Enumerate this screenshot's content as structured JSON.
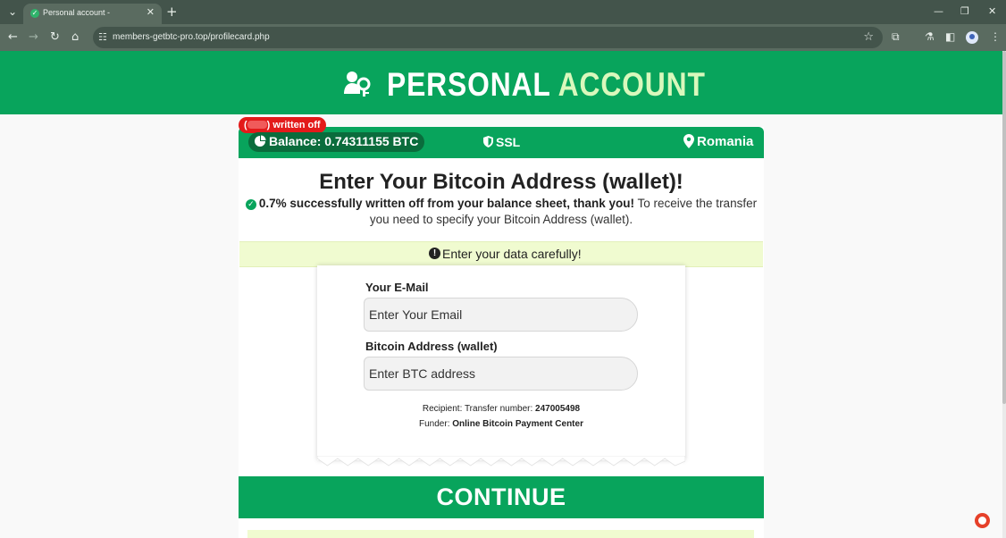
{
  "browser": {
    "tab_title": "Personal account -",
    "url": "members-getbtc-pro.top/profilecard.php"
  },
  "header": {
    "title_part1": "PERSONAL",
    "title_part2": "ACCOUNT"
  },
  "status": {
    "badge_open": "(",
    "badge_text": ") written off",
    "balance": "Balance: 0.74311155 BTC",
    "ssl": "SSL",
    "country": "Romania"
  },
  "main": {
    "headline": "Enter Your Bitcoin Address (wallet)!",
    "success_bold": "0.7% successfully written off from your balance sheet, thank you!",
    "success_rest": "To receive the transfer you need to specify your Bitcoin Address (wallet).",
    "notice": "Enter your data carefully!"
  },
  "form": {
    "email_label": "Your E-Mail",
    "email_placeholder": "Enter Your Email",
    "btc_label": "Bitcoin Address (wallet)",
    "btc_placeholder": "Enter BTC address",
    "recipient_label": "Recipient: Transfer number:",
    "recipient_value": "247005498",
    "funder_label": "Funder:",
    "funder_value": "Online Bitcoin Payment Center"
  },
  "cta": {
    "continue_label": "CONTINUE"
  },
  "colors": {
    "brand_green": "#08a45c",
    "dark_green": "#0a6c3c",
    "notice_bg": "#f0fbd0",
    "badge_red": "#e31a1a"
  }
}
